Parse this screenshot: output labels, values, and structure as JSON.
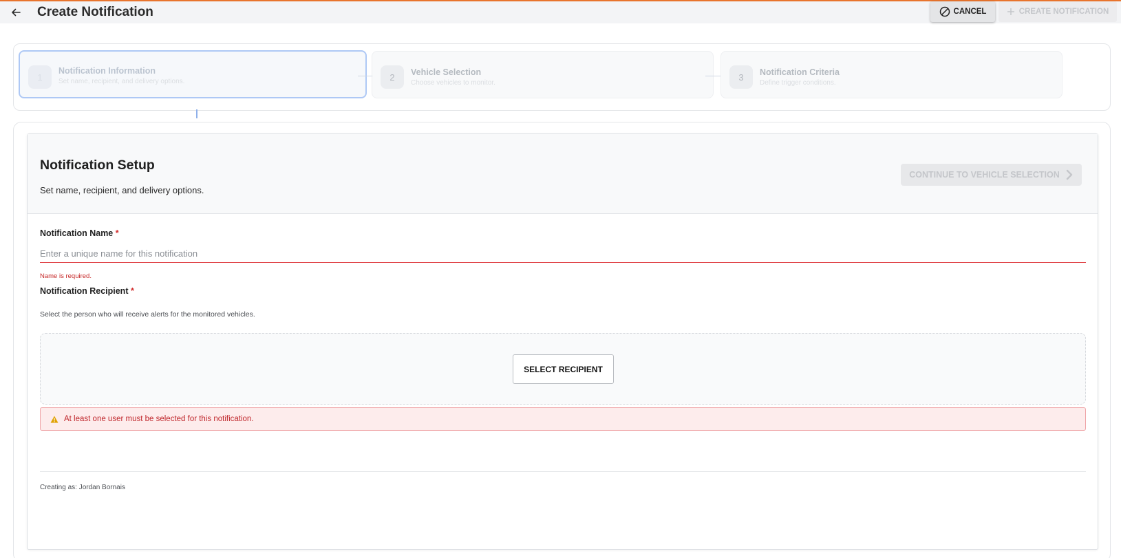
{
  "header": {
    "title": "Create Notification",
    "cancel_label": "CANCEL",
    "create_label": "CREATE NOTIFICATION"
  },
  "steps": [
    {
      "number": "1",
      "title": "Notification Information",
      "subtitle": "Set name, recipient, and delivery options.",
      "state": "active"
    },
    {
      "number": "2",
      "title": "Vehicle Selection",
      "subtitle": "Choose vehicles to monitor.",
      "state": "inactive"
    },
    {
      "number": "3",
      "title": "Notification Criteria",
      "subtitle": "Define trigger conditions.",
      "state": "inactive"
    }
  ],
  "setup": {
    "title": "Notification Setup",
    "subtitle": "Set name, recipient, and delivery options.",
    "continue_label": "CONTINUE TO VEHICLE SELECTION"
  },
  "name_field": {
    "label": "Notification Name",
    "required_mark": "*",
    "placeholder": "Enter a unique name for this notification",
    "value": "",
    "error": "Name is required."
  },
  "recipient_field": {
    "label": "Notification Recipient",
    "required_mark": "*",
    "help": "Select the person who will receive alerts for the monitored vehicles.",
    "select_label": "SELECT RECIPIENT",
    "alert": "At least one user must be selected for this notification."
  },
  "footer": {
    "creating_as": "Creating as: Jordan Bornais"
  },
  "colors": {
    "accent_top": "#e8742d",
    "error": "#d32f2f",
    "active_step_border": "#93b6f2"
  },
  "icons": {
    "back": "arrow-left-icon",
    "cancel": "ban-icon",
    "create": "plus-icon",
    "continue": "chevron-right-icon",
    "alert": "warning-icon"
  }
}
